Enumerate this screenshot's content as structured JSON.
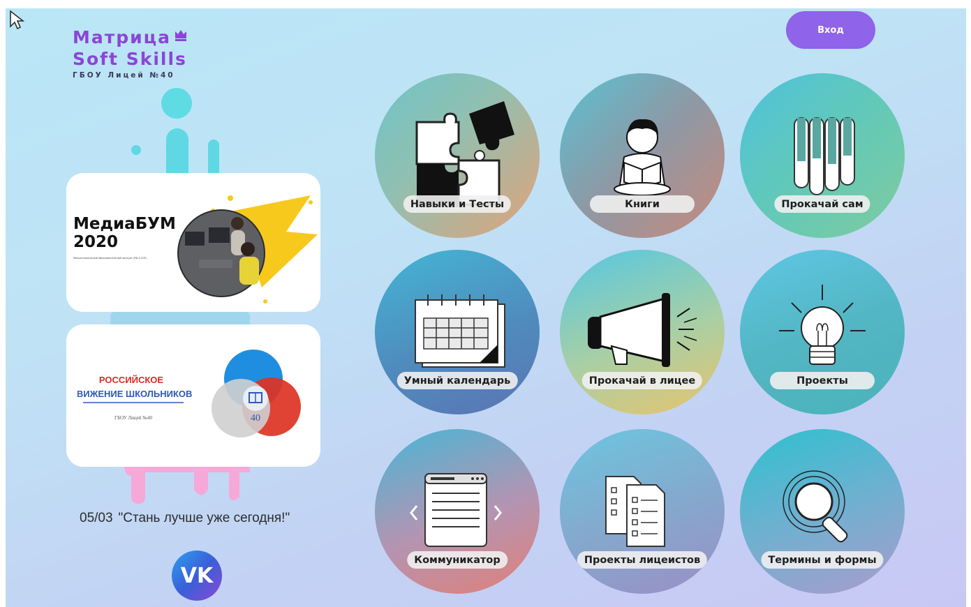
{
  "logo": {
    "line1": "Матрица",
    "line2": "Soft Skills",
    "subtitle": "ГБОУ Лицей №40",
    "crown_icon": "crown-icon"
  },
  "header": {
    "login_label": "Вход"
  },
  "cards": {
    "mediabum": {
      "line1": "МедиаБУМ",
      "line2": "2020",
      "small_text": "Межрегиональный образовательный конкурс (РФ и СНГ)"
    },
    "rdsh": {
      "line1": "РОССИЙСКОЕ",
      "line2": "ДВИЖЕНИЕ ШКОЛЬНИКОВ",
      "subtitle": "ГБОУ Лицей №40",
      "emblem_number": "40"
    }
  },
  "news": {
    "date": "05/03",
    "text": "\"Стань лучше уже сегодня!\""
  },
  "social": {
    "vk_label": "VK"
  },
  "tiles": [
    {
      "label": "Навыки и Тесты",
      "icon": "puzzle-icon"
    },
    {
      "label": "Книги",
      "icon": "reader-icon"
    },
    {
      "label": "Прокачай сам",
      "icon": "test-tubes-icon"
    },
    {
      "label": "Умный календарь",
      "icon": "calendar-icon"
    },
    {
      "label": "Прокачай в лицее",
      "icon": "megaphone-icon"
    },
    {
      "label": "Проекты",
      "icon": "lightbulb-icon"
    },
    {
      "label": "Коммуникатор",
      "icon": "browser-window-icon"
    },
    {
      "label": "Проекты лицеистов",
      "icon": "checklist-documents-icon"
    },
    {
      "label": "Термины и формы",
      "icon": "magnifier-icon"
    }
  ],
  "colors": {
    "accent": "#8f63ea",
    "logo": "#8a46d6"
  }
}
